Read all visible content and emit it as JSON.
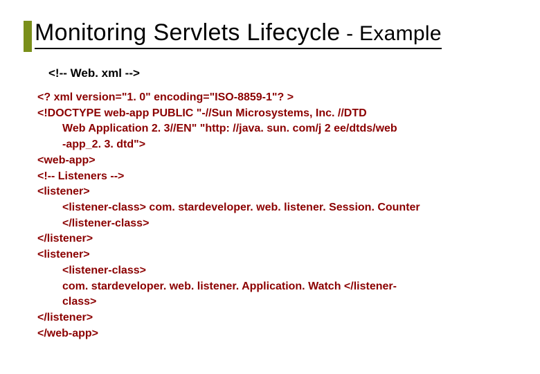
{
  "title_main": "Monitoring Servlets Lifecycle",
  "title_suffix": " - Example",
  "comment": "<!-- Web. xml -->",
  "code_lines": [
    {
      "text": "<? xml version=\"1. 0\" encoding=\"ISO-8859-1\"? >",
      "indent": false
    },
    {
      "text": "<!DOCTYPE web-app PUBLIC \"-//Sun Microsystems, Inc. //DTD",
      "indent": false
    },
    {
      "text": "Web Application 2. 3//EN\" \"http: //java. sun. com/j 2 ee/dtds/web",
      "indent": true
    },
    {
      "text": "-app_2. 3. dtd\">",
      "indent": true
    },
    {
      "text": "<web-app>",
      "indent": false
    },
    {
      "text": "<!-- Listeners -->",
      "indent": false
    },
    {
      "text": "<listener>",
      "indent": false
    },
    {
      "text": "<listener-class> com. stardeveloper. web. listener. Session. Counter",
      "indent": true
    },
    {
      "text": "</listener-class>",
      "indent": true
    },
    {
      "text": "</listener>",
      "indent": false
    },
    {
      "text": "<listener>",
      "indent": false
    },
    {
      "text": "<listener-class>",
      "indent": true
    },
    {
      "text": "com. stardeveloper. web. listener. Application. Watch </listener-",
      "indent": true
    },
    {
      "text": "class>",
      "indent": true
    },
    {
      "text": "</listener>",
      "indent": false
    },
    {
      "text": "</web-app>",
      "indent": false
    }
  ]
}
